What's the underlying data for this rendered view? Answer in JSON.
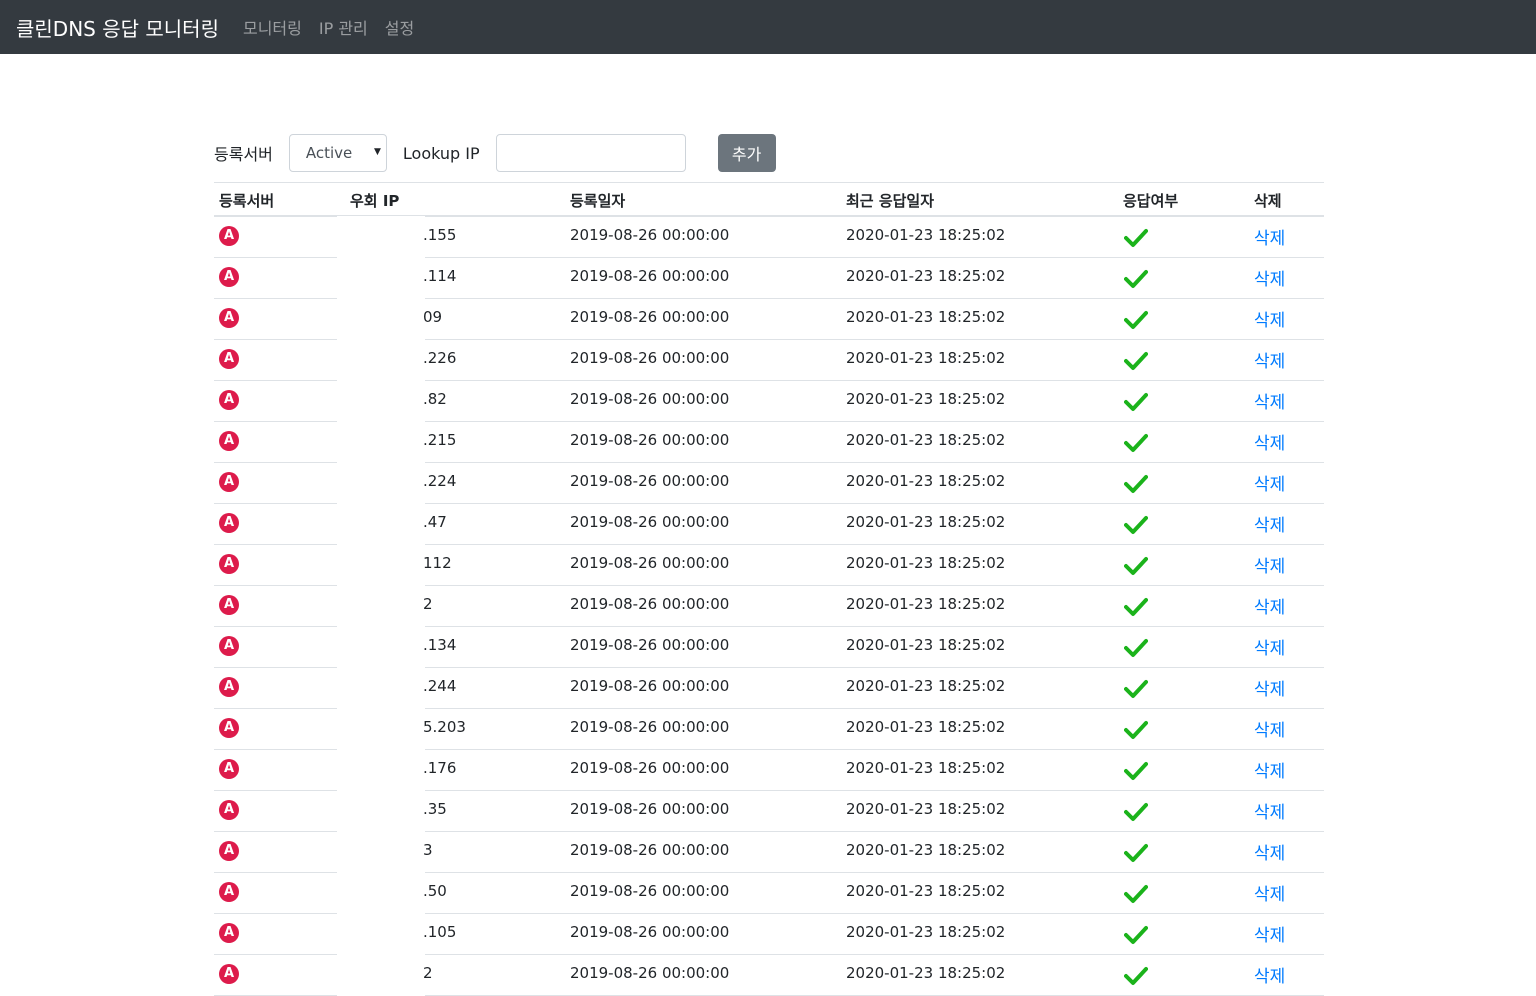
{
  "navbar": {
    "brand": "클린DNS 응답 모니터링",
    "links": [
      "모니터링",
      "IP 관리",
      "설정"
    ]
  },
  "form": {
    "server_label": "등록서버",
    "server_select_value": "Active",
    "lookup_label": "Lookup IP",
    "lookup_value": "",
    "add_button": "추가"
  },
  "table": {
    "headers": [
      "등록서버",
      "우회 IP",
      "등록일자",
      "최근 응답일자",
      "응답여부",
      "삭제"
    ],
    "badge_letter": "A",
    "delete_label": "삭제",
    "rows": [
      {
        "ip": ".155",
        "registered": "2019-08-26 00:00:00",
        "last": "2020-01-23 18:25:02"
      },
      {
        "ip": ".114",
        "registered": "2019-08-26 00:00:00",
        "last": "2020-01-23 18:25:02"
      },
      {
        "ip": "09",
        "registered": "2019-08-26 00:00:00",
        "last": "2020-01-23 18:25:02"
      },
      {
        "ip": ".226",
        "registered": "2019-08-26 00:00:00",
        "last": "2020-01-23 18:25:02"
      },
      {
        "ip": ".82",
        "registered": "2019-08-26 00:00:00",
        "last": "2020-01-23 18:25:02"
      },
      {
        "ip": ".215",
        "registered": "2019-08-26 00:00:00",
        "last": "2020-01-23 18:25:02"
      },
      {
        "ip": ".224",
        "registered": "2019-08-26 00:00:00",
        "last": "2020-01-23 18:25:02"
      },
      {
        "ip": ".47",
        "registered": "2019-08-26 00:00:00",
        "last": "2020-01-23 18:25:02"
      },
      {
        "ip": "112",
        "registered": "2019-08-26 00:00:00",
        "last": "2020-01-23 18:25:02"
      },
      {
        "ip": "2",
        "registered": "2019-08-26 00:00:00",
        "last": "2020-01-23 18:25:02"
      },
      {
        "ip": ".134",
        "registered": "2019-08-26 00:00:00",
        "last": "2020-01-23 18:25:02"
      },
      {
        "ip": ".244",
        "registered": "2019-08-26 00:00:00",
        "last": "2020-01-23 18:25:02"
      },
      {
        "ip": "5.203",
        "registered": "2019-08-26 00:00:00",
        "last": "2020-01-23 18:25:02"
      },
      {
        "ip": ".176",
        "registered": "2019-08-26 00:00:00",
        "last": "2020-01-23 18:25:02"
      },
      {
        "ip": ".35",
        "registered": "2019-08-26 00:00:00",
        "last": "2020-01-23 18:25:02"
      },
      {
        "ip": "3",
        "registered": "2019-08-26 00:00:00",
        "last": "2020-01-23 18:25:02"
      },
      {
        "ip": ".50",
        "registered": "2019-08-26 00:00:00",
        "last": "2020-01-23 18:25:02"
      },
      {
        "ip": ".105",
        "registered": "2019-08-26 00:00:00",
        "last": "2020-01-23 18:25:02"
      },
      {
        "ip": "2",
        "registered": "2019-08-26 00:00:00",
        "last": "2020-01-23 18:25:02"
      }
    ]
  },
  "colors": {
    "navbar_bg": "#343a40",
    "badge": "#dd1b4b",
    "check": "#1bb31b",
    "link": "#007bff",
    "button": "#6c757d"
  }
}
